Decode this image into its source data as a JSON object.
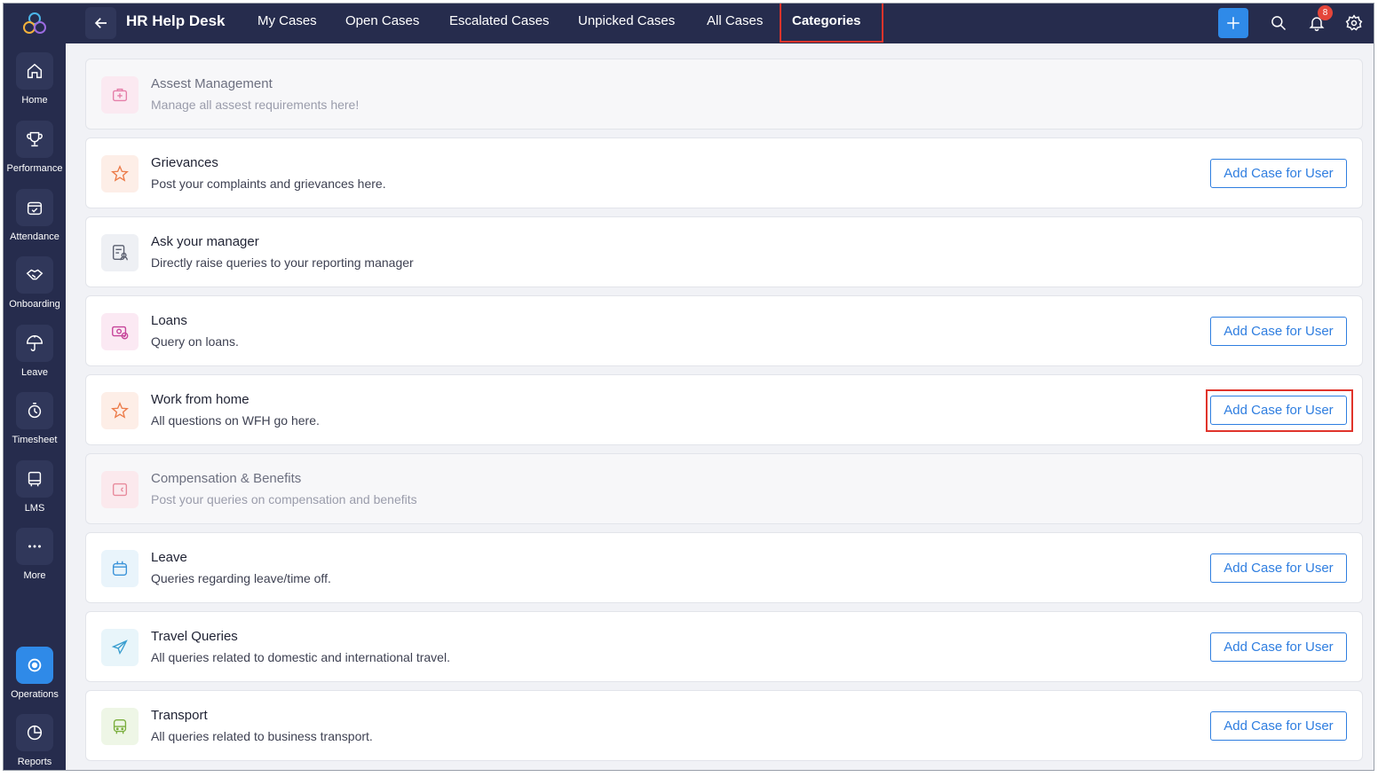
{
  "colors": {
    "sidebar_bg": "#262c4d",
    "accent": "#2f8ae8",
    "highlight": "#e0342b",
    "button_text": "#2f7ee0"
  },
  "sidebar": {
    "items": [
      {
        "label": "Home",
        "icon": "home-icon"
      },
      {
        "label": "Performance",
        "icon": "trophy-icon"
      },
      {
        "label": "Attendance",
        "icon": "calendar-check-icon"
      },
      {
        "label": "Onboarding",
        "icon": "handshake-icon"
      },
      {
        "label": "Leave",
        "icon": "umbrella-icon"
      },
      {
        "label": "Timesheet",
        "icon": "timer-icon"
      },
      {
        "label": "LMS",
        "icon": "book-icon"
      },
      {
        "label": "More",
        "icon": "more-dots-icon"
      },
      {
        "label": "Operations",
        "icon": "operations-icon",
        "active": true
      },
      {
        "label": "Reports",
        "icon": "pie-chart-icon"
      }
    ]
  },
  "header": {
    "title": "HR Help Desk",
    "tabs": [
      {
        "label": "My Cases"
      },
      {
        "label": "Open Cases"
      },
      {
        "label": "Escalated Cases"
      },
      {
        "label": "Unpicked Cases"
      },
      {
        "label": "All Cases"
      },
      {
        "label": "Categories",
        "active": true
      }
    ],
    "notification_count": "8"
  },
  "categories": [
    {
      "title": "Assest Management",
      "desc": "Manage all assest requirements here!",
      "icon": "briefcase-plus-icon",
      "disabled": true,
      "button": ""
    },
    {
      "title": "Grievances",
      "desc": "Post your complaints and grievances here.",
      "icon": "star-icon",
      "button": "Add Case for User"
    },
    {
      "title": "Ask your manager",
      "desc": "Directly raise queries to your reporting manager",
      "icon": "manager-form-icon",
      "button": ""
    },
    {
      "title": "Loans",
      "desc": "Query on loans.",
      "icon": "money-icon",
      "button": "Add Case for User"
    },
    {
      "title": "Work from home",
      "desc": "All questions on WFH go here.",
      "icon": "star-icon",
      "button": "Add Case for User",
      "highlighted": true
    },
    {
      "title": "Compensation & Benefits",
      "desc": "Post your queries on compensation and benefits",
      "icon": "wallet-icon",
      "disabled": true,
      "button": ""
    },
    {
      "title": "Leave",
      "desc": "Queries regarding leave/time off.",
      "icon": "calendar-icon",
      "button": "Add Case for User"
    },
    {
      "title": "Travel Queries",
      "desc": "All queries related to domestic and international travel.",
      "icon": "plane-icon",
      "button": "Add Case for User"
    },
    {
      "title": "Transport",
      "desc": "All queries related to business transport.",
      "icon": "bus-icon",
      "button": "Add Case for User"
    }
  ]
}
